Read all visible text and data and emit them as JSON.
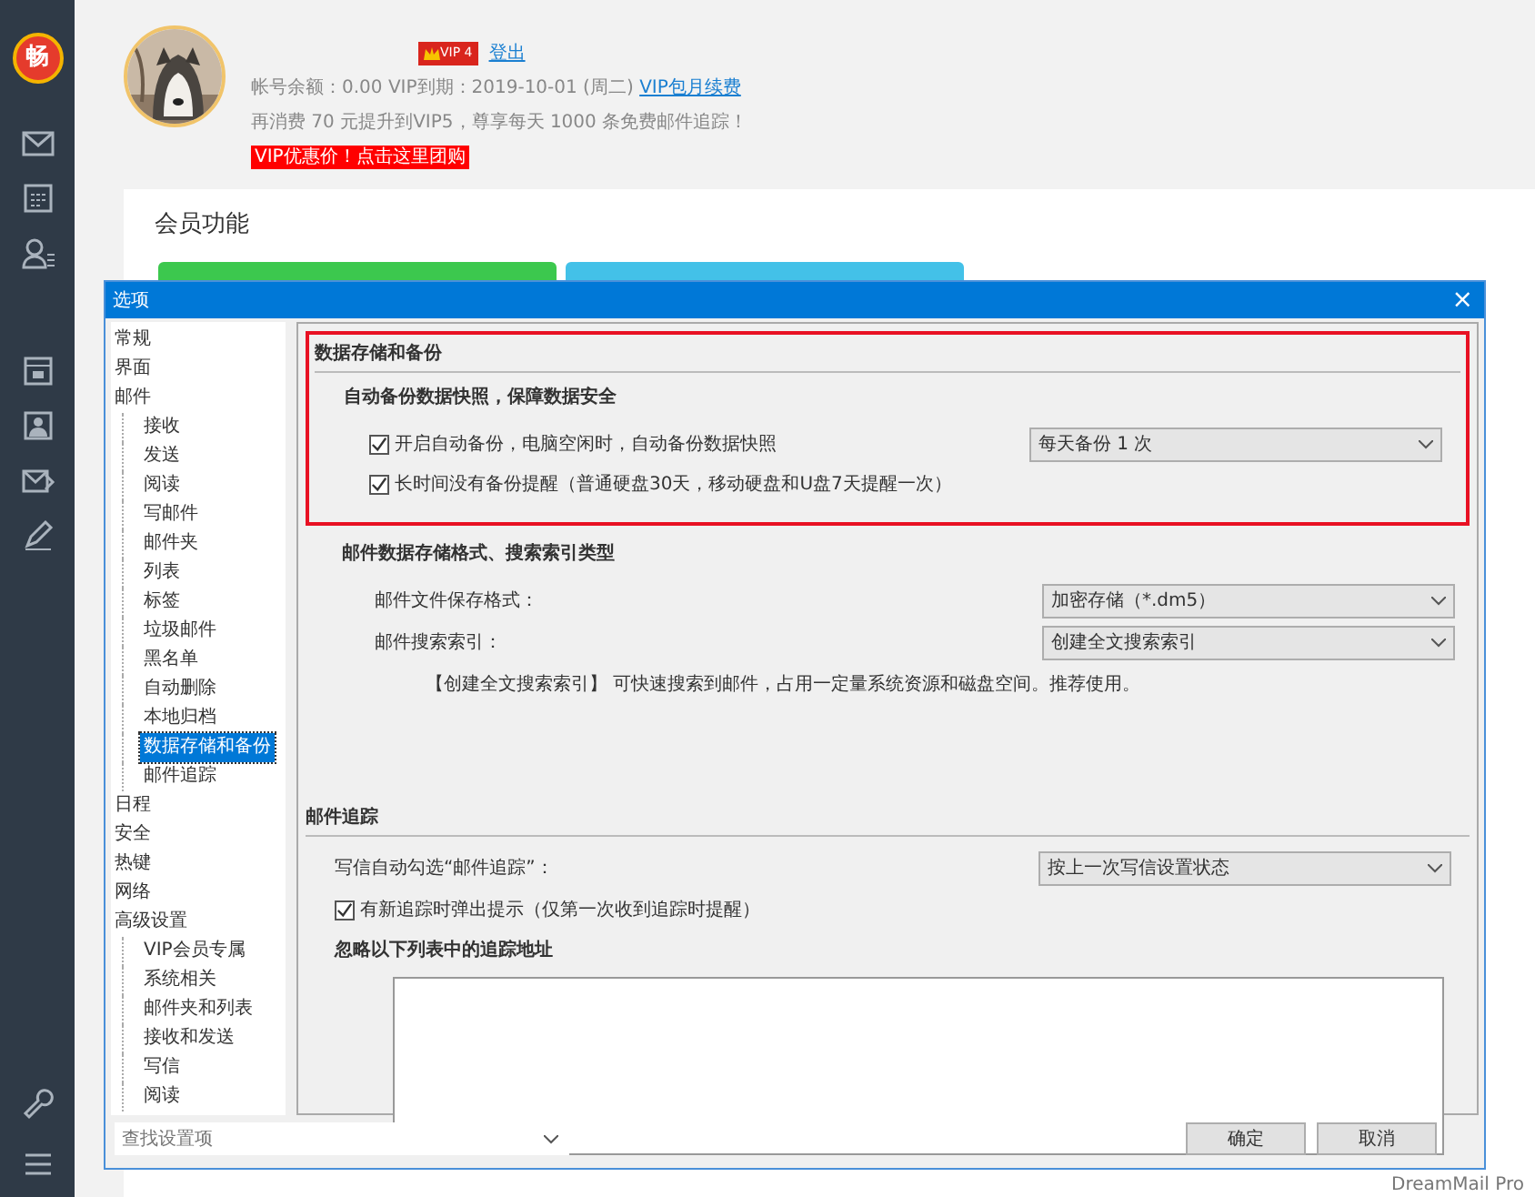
{
  "app": {
    "logo": "畅",
    "footer": "DreamMail Pro"
  },
  "sidebar": {
    "items": [
      {
        "kind": "mail"
      },
      {
        "kind": "calendar"
      },
      {
        "kind": "contacts"
      },
      {
        "kind": "date"
      },
      {
        "kind": "card"
      },
      {
        "kind": "send"
      },
      {
        "kind": "pen"
      }
    ],
    "bottom": [
      {
        "kind": "wrench"
      },
      {
        "kind": "menu"
      }
    ]
  },
  "profile": {
    "vip_badge": "VIP 4",
    "logout": "登出",
    "account_line": "帐号余额：0.00    VIP到期：2019-10-01 (周二)",
    "renew_link": "VIP包月续费",
    "upgrade_note": "再消费 70 元提升到VIP5，尊享每天 1000 条免费邮件追踪！",
    "promo": "VIP优惠价！点击这里团购"
  },
  "card": {
    "title": "会员功能"
  },
  "dialog": {
    "title": "选项",
    "close": "×",
    "tree": [
      {
        "label": "常规",
        "selected": false
      },
      {
        "label": "界面",
        "selected": false
      },
      {
        "label": "邮件",
        "selected": false,
        "children": [
          {
            "label": "接收",
            "selected": false
          },
          {
            "label": "发送",
            "selected": false
          },
          {
            "label": "阅读",
            "selected": false
          },
          {
            "label": "写邮件",
            "selected": false
          },
          {
            "label": "邮件夹",
            "selected": false
          },
          {
            "label": "列表",
            "selected": false
          },
          {
            "label": "标签",
            "selected": false
          },
          {
            "label": "垃圾邮件",
            "selected": false
          },
          {
            "label": "黑名单",
            "selected": false
          },
          {
            "label": "自动删除",
            "selected": false
          },
          {
            "label": "本地归档",
            "selected": false
          },
          {
            "label": "数据存储和备份",
            "selected": true
          },
          {
            "label": "邮件追踪",
            "selected": false
          }
        ]
      },
      {
        "label": "日程",
        "selected": false
      },
      {
        "label": "安全",
        "selected": false
      },
      {
        "label": "热键",
        "selected": false
      },
      {
        "label": "网络",
        "selected": false
      },
      {
        "label": "高级设置",
        "selected": false,
        "children": [
          {
            "label": "VIP会员专属",
            "selected": false
          },
          {
            "label": "系统相关",
            "selected": false
          },
          {
            "label": "邮件夹和列表",
            "selected": false
          },
          {
            "label": "接收和发送",
            "selected": false
          },
          {
            "label": "写信",
            "selected": false
          },
          {
            "label": "阅读",
            "selected": false
          }
        ]
      }
    ],
    "backup": {
      "heading": "数据存储和备份",
      "subheading": "自动备份数据快照，保障数据安全",
      "highlighted": true,
      "options": [
        {
          "label": "开启自动备份，电脑空闲时，自动备份数据快照",
          "checked": true,
          "select": "每天备份 1 次"
        },
        {
          "label": "长时间没有备份提醒（普通硬盘30天，移动硬盘和U盘7天提醒一次）",
          "checked": true
        }
      ]
    },
    "storage": {
      "heading": "邮件数据存储格式、搜索索引类型",
      "fields": [
        {
          "label": "邮件文件保存格式：",
          "value": "加密存储（*.dm5）"
        },
        {
          "label": "邮件搜索索引：",
          "value": "创建全文搜索索引"
        }
      ],
      "note": "【创建全文搜索索引】 可快速搜索到邮件，占用一定量系统资源和磁盘空间。推荐使用。"
    },
    "tracking": {
      "heading": "邮件追踪",
      "auto_label": "写信自动勾选“邮件追踪”：",
      "auto_value": "按上一次写信设置状态",
      "popup": {
        "label": "有新追踪时弹出提示（仅第一次收到追踪时提醒）",
        "checked": true
      },
      "ignore_heading": "忽略以下列表中的追踪地址"
    },
    "search": {
      "placeholder": "查找设置项"
    },
    "buttons": [
      "确定",
      "取消"
    ]
  }
}
